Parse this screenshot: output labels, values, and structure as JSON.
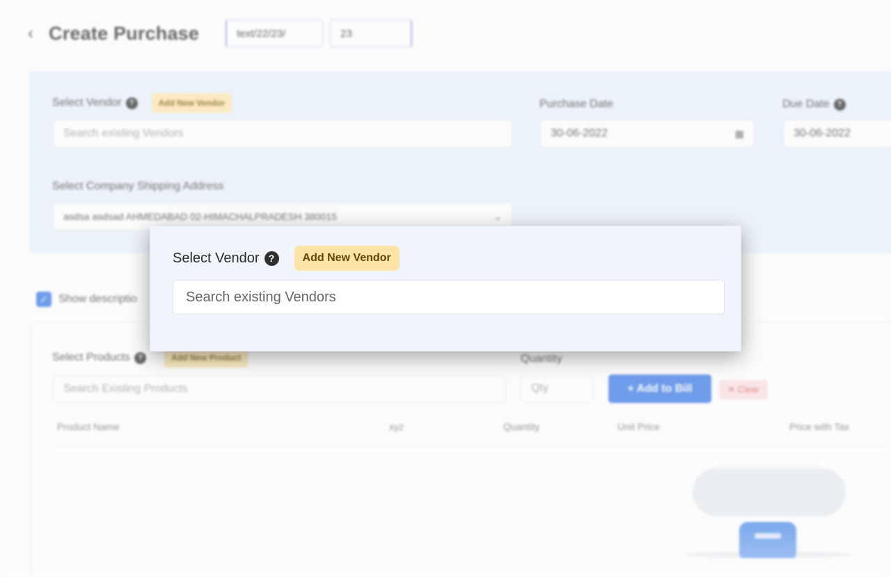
{
  "header": {
    "title": "Create Purchase",
    "prefix_value": "text/22/23/",
    "number_value": "23"
  },
  "vendor_section": {
    "select_vendor_label": "Select Vendor",
    "add_vendor_label": "Add New Vendor",
    "vendor_placeholder": "Search existing Vendors",
    "purchase_date_label": "Purchase Date",
    "purchase_date_value": "30-06-2022",
    "due_date_label": "Due Date",
    "due_date_value": "30-06-2022",
    "shipping_label": "Select Company Shipping Address",
    "shipping_value": "asdsa asdsad AHMEDABAD 02-HIMACHALPRADESH 380015"
  },
  "description_toggle": {
    "label": "Show descriptio",
    "checked": true
  },
  "products_section": {
    "select_products_label": "Select Products",
    "add_product_label": "Add New Product",
    "products_placeholder": "Search Existing Products",
    "quantity_label": "Quantity",
    "qty_placeholder": "Qty",
    "add_to_bill_label": "+ Add to Bill",
    "clear_label": "✕ Clear",
    "columns": [
      "Product Name",
      "xyz",
      "Quantity",
      "Unit Price",
      "Price with Tax"
    ]
  },
  "focus_popup": {
    "label": "Select Vendor",
    "help_glyph": "?",
    "add_button_label": "Add New Vendor",
    "search_placeholder": "Search existing Vendors"
  },
  "colors": {
    "primary": "#3d7be6",
    "badge_bg": "#fde3a8",
    "panel_bg": "#eaf2fc"
  },
  "icons": {
    "back": "chevron-left-icon",
    "help": "question-circle-icon",
    "calendar": "calendar-icon",
    "dropdown": "chevron-down-icon",
    "empty": "empty-box-icon"
  }
}
